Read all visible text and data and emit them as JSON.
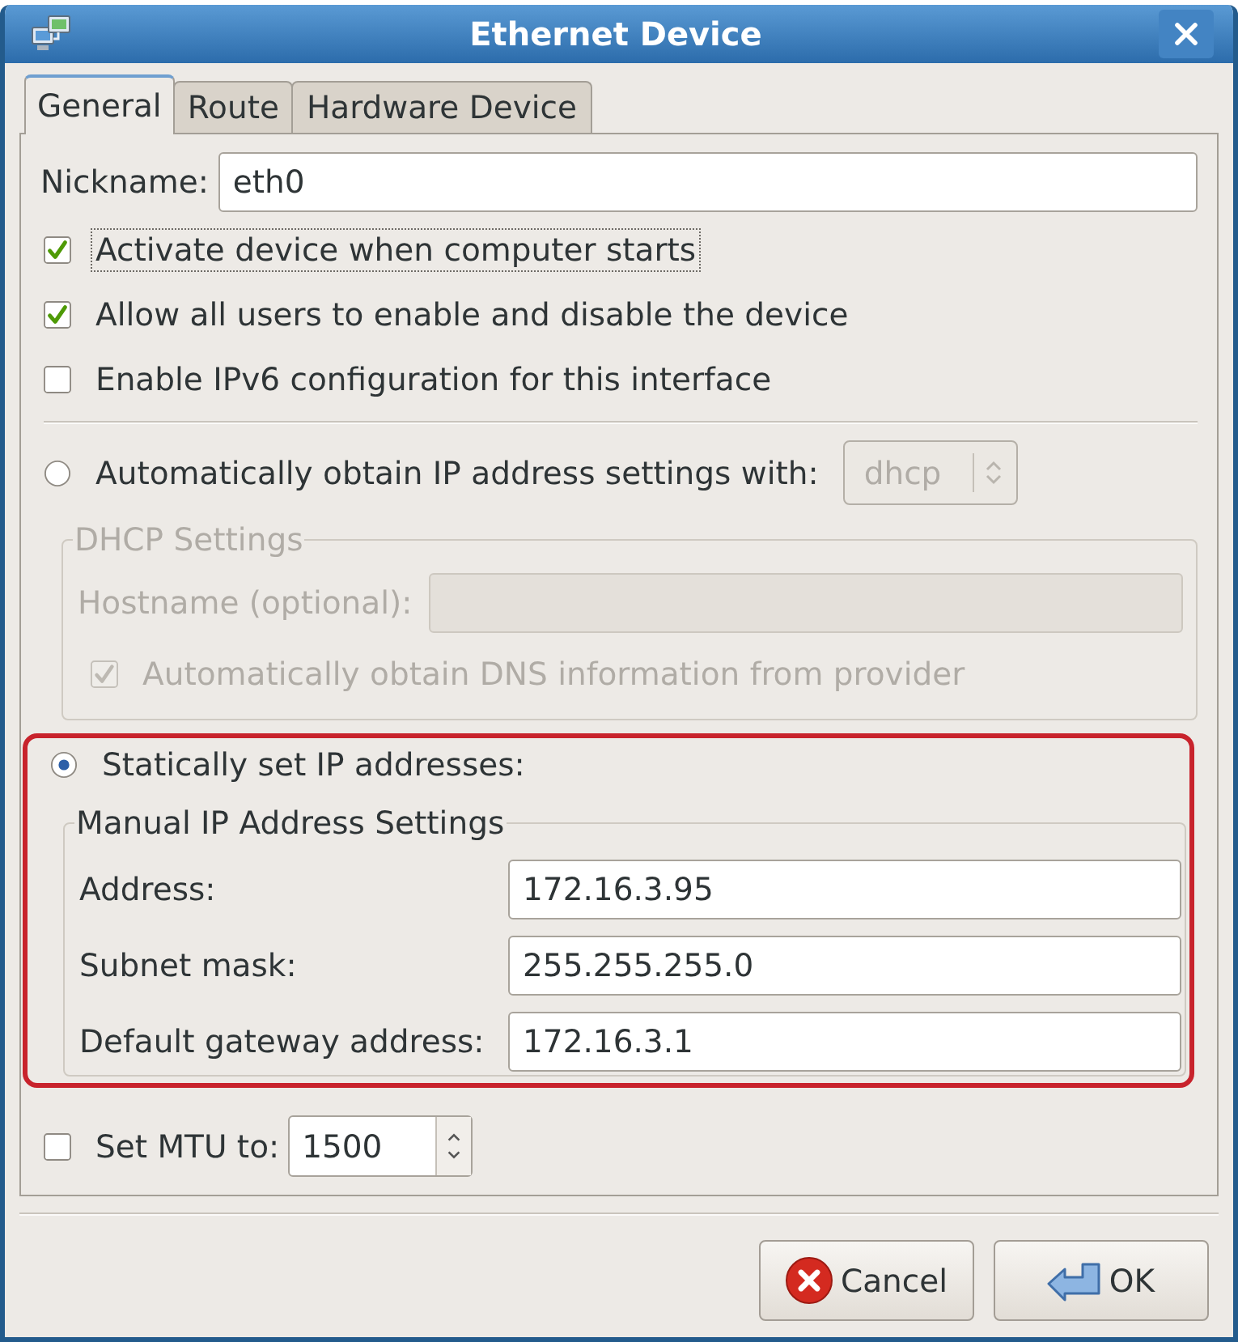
{
  "window": {
    "title": "Ethernet Device"
  },
  "tabs": [
    {
      "label": "General",
      "selected": true
    },
    {
      "label": "Route",
      "selected": false
    },
    {
      "label": "Hardware Device",
      "selected": false
    }
  ],
  "nickname": {
    "label": "Nickname:",
    "value": "eth0"
  },
  "options": [
    {
      "label": "Activate device when computer starts",
      "checked": true,
      "focused": true
    },
    {
      "label": "Allow all users to enable and disable the device",
      "checked": true,
      "focused": false
    },
    {
      "label": "Enable IPv6 configuration for this interface",
      "checked": false,
      "focused": false
    }
  ],
  "automatic": {
    "label": "Automatically obtain IP address settings with:",
    "selected": false,
    "method": {
      "value": "dhcp",
      "disabled": true
    },
    "dhcp_settings": {
      "title": "DHCP Settings",
      "disabled": true,
      "hostname": {
        "label": "Hostname (optional):"
      },
      "dns": {
        "label": "Automatically obtain DNS information from provider",
        "checked": true
      }
    }
  },
  "static": {
    "label": "Statically set IP addresses:",
    "selected": true,
    "highlighted": true,
    "settings": {
      "title": "Manual IP Address Settings",
      "fields": [
        {
          "label": "Address:",
          "value": "172.16.3.95"
        },
        {
          "label": "Subnet mask:",
          "value": "255.255.255.0"
        },
        {
          "label": "Default gateway address:",
          "value": "172.16.3.1"
        }
      ]
    }
  },
  "mtu": {
    "label": "Set MTU to:",
    "checked": false,
    "value": "1500"
  },
  "buttons": [
    {
      "kind": "cancel",
      "label": "Cancel"
    },
    {
      "kind": "ok",
      "label": "OK"
    }
  ]
}
